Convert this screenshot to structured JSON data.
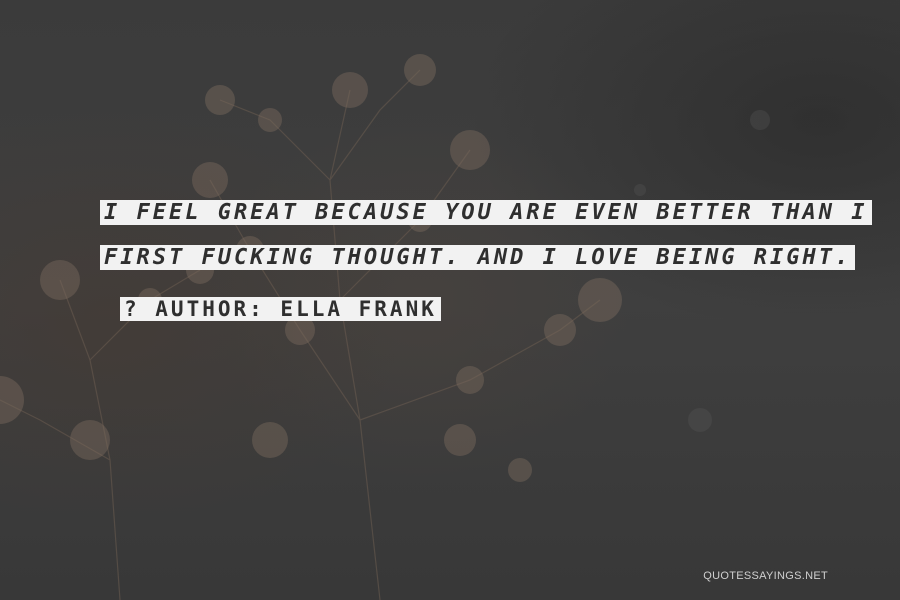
{
  "quote": {
    "line1": "I FEEL GREAT BECAUSE YOU ARE EVEN BETTER THAN I",
    "line2": "FIRST FUCKING THOUGHT. AND I LOVE BEING RIGHT."
  },
  "author": {
    "label": "? AUTHOR: ELLA FRANK"
  },
  "watermark": {
    "text": "QUOTESSAYINGS.NET"
  },
  "colors": {
    "highlight": "#f2f2f2",
    "text": "#2f2f2f",
    "background": "#3a3a3a"
  }
}
